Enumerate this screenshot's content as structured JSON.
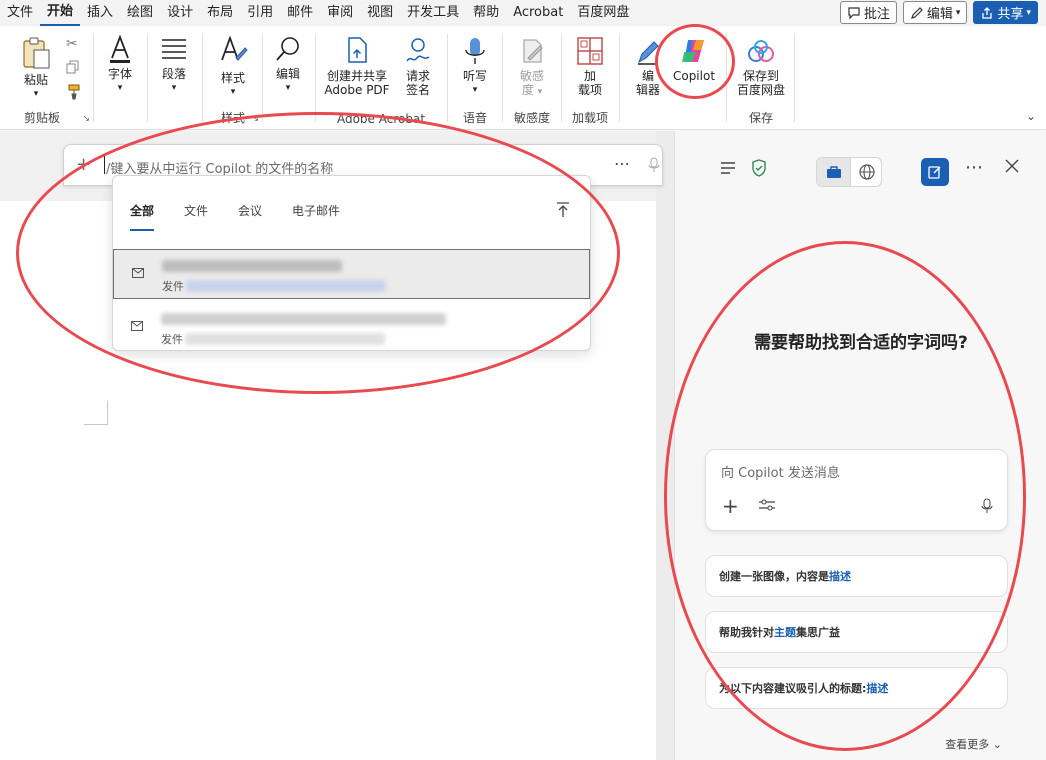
{
  "menu": {
    "items": [
      "文件",
      "开始",
      "插入",
      "绘图",
      "设计",
      "布局",
      "引用",
      "邮件",
      "审阅",
      "视图",
      "开发工具",
      "帮助",
      "Acrobat",
      "百度网盘"
    ],
    "active_index": 1,
    "comment_label": "批注",
    "edit_label": "编辑",
    "share_label": "共享"
  },
  "ribbon": {
    "paste_label": "粘贴",
    "clipboard_label": "剪贴板",
    "font_label": "字体",
    "paragraph_label": "段落",
    "styles_label": "样式",
    "styles_group_label": "样式",
    "editing_label": "编辑",
    "create_share_line1": "创建并共享",
    "create_share_line2": "Adobe PDF",
    "request_sign_line1": "请求",
    "request_sign_line2": "签名",
    "acrobat_group_label": "Adobe Acrobat",
    "dictate_label": "听写",
    "voice_group_label": "语音",
    "sensitivity_line1": "敏感",
    "sensitivity_line2": "度",
    "sensitivity_group_label": "敏感度",
    "addins_line1": "加",
    "addins_line2": "载项",
    "addins_group_label": "加载项",
    "editor_line1": "编",
    "editor_line2": "辑器",
    "copilot_label": "Copilot",
    "save_baidu_line1": "保存到",
    "save_baidu_line2": "百度网盘",
    "save_group_label": "保存"
  },
  "prompt": {
    "placeholder": "/键入要从中运行 Copilot 的文件的名称"
  },
  "dropdown": {
    "tabs": [
      "全部",
      "文件",
      "会议",
      "电子邮件"
    ],
    "active_tab": 0,
    "rows": [
      {
        "sub": "发件"
      },
      {
        "sub": "发件"
      }
    ]
  },
  "pane": {
    "title": "需要帮助找到合适的字词吗?",
    "message_placeholder": "向 Copilot 发送消息",
    "suggestions": [
      {
        "text": "创建一张图像，内容是 ",
        "highlight": "描述",
        "tail": ""
      },
      {
        "text": "帮助我针对",
        "highlight": "主题",
        "tail": "集思广益"
      },
      {
        "text": "为以下内容建议吸引人的标题: ",
        "highlight": "描述",
        "tail": ""
      }
    ],
    "see_more": "查看更多"
  },
  "colors": {
    "accent": "#1a5fb4",
    "annotation": "#e84a4f"
  }
}
